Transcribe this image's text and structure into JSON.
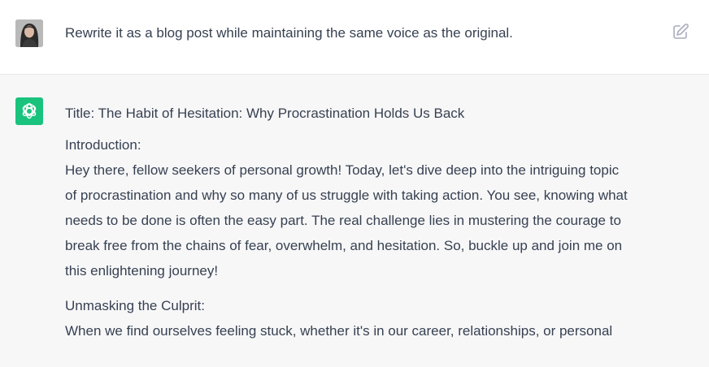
{
  "user_message": {
    "text": "Rewrite it as a blog post while maintaining the same voice as the original.",
    "avatar_icon": "user-avatar-photo",
    "edit_icon": "edit-icon"
  },
  "assistant_message": {
    "avatar_icon": "openai-logo-icon",
    "avatar_color": "#19c37d",
    "title": "Title: The Habit of Hesitation: Why Procrastination Holds Us Back",
    "sections": [
      {
        "heading": "Introduction:",
        "lines": [
          "Hey there, fellow seekers of personal growth! Today, let's dive deep into the intriguing topic",
          "of procrastination and why so many of us struggle with taking action. You see, knowing what",
          "needs to be done is often the easy part. The real challenge lies in mustering the courage to",
          "break free from the chains of fear, overwhelm, and hesitation. So, buckle up and join me on",
          "this enlightening journey!"
        ]
      },
      {
        "heading": "Unmasking the Culprit:",
        "lines": [
          "When we find ourselves feeling stuck, whether it's in our career, relationships, or personal"
        ]
      }
    ]
  },
  "colors": {
    "user_bg": "#ffffff",
    "assistant_bg": "#f7f7f8",
    "text": "#374151",
    "divider": "#e5e7eb"
  }
}
